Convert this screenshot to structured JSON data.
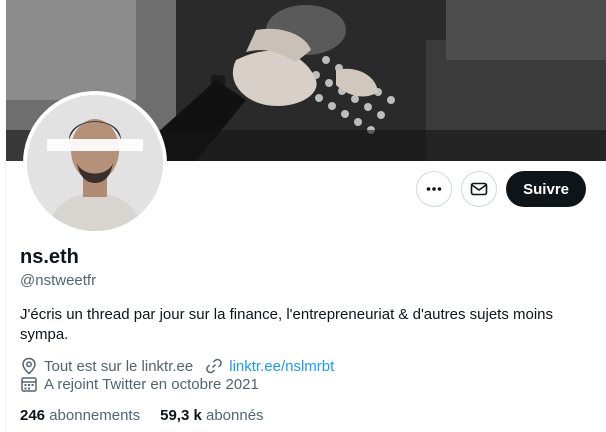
{
  "profile": {
    "display_name": "ns.eth",
    "handle": "@nstweetfr",
    "bio": "J'écris un thread par jour sur la finance, l'entrepreneuriat & d'autres sujets moins sympa.",
    "location": "Tout est sur le linktr.ee",
    "website": "linktr.ee/nslmrbt",
    "joined": "A rejoint Twitter en octobre 2021",
    "following_count": "246",
    "following_label": "abonnements",
    "followers_count": "59,3 k",
    "followers_label": "abonnés"
  },
  "actions": {
    "more_icon": "more-icon",
    "message_icon": "envelope-icon",
    "follow_label": "Suivre"
  },
  "colors": {
    "link": "#1d9bf0",
    "text_secondary": "#536471",
    "button_dark": "#0f1419"
  }
}
